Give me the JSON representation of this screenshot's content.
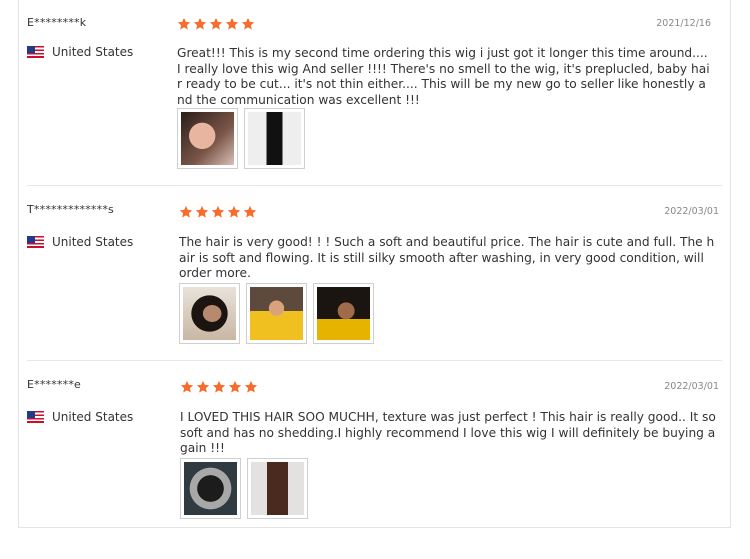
{
  "accent_color": "#f86b2d",
  "reviews": [
    {
      "name": "E********k",
      "country": "United States",
      "rating": 5,
      "date": "2021/12/16",
      "text": "Great!!! This is my second time ordering this wig i just got it longer this time around.... I really love this wig And seller !!!! There's no smell to the wig, it's preplucled, baby hair ready to be cut... it's not thin either.... This will be my new go to seller like honestly and the communication was excellent !!!",
      "photo_count": 2
    },
    {
      "name": "T*************s",
      "country": "United States",
      "rating": 5,
      "date": "2022/03/01",
      "text": "The hair is very good! ! ! Such a soft and beautiful price. The hair is cute and full. The hair is soft and flowing. It is still silky smooth after washing, in very good condition, will order more.",
      "photo_count": 3
    },
    {
      "name": "E*******e",
      "country": "United States",
      "rating": 5,
      "date": "2022/03/01",
      "text": "I LOVED THIS HAIR SOO MUCHH, texture was just perfect ! This hair is really good.. It so soft and has no shedding.I highly recommend I love this wig I will definitely be buying again !!!",
      "photo_count": 2
    }
  ]
}
